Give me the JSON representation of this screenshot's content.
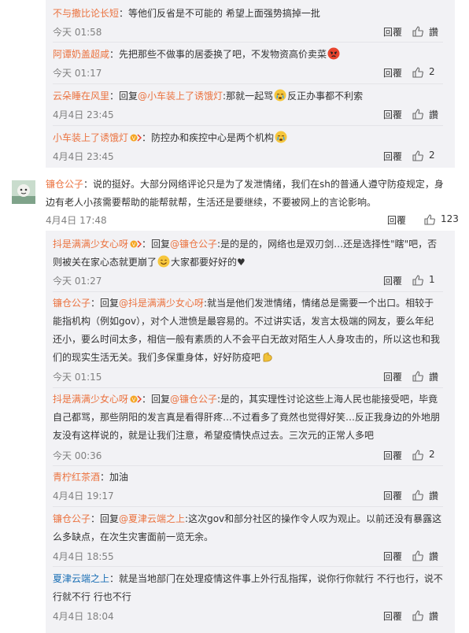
{
  "sub_replies_top": [
    {
      "user": "不与撒比论长短",
      "user_color": "#eb7340",
      "sep": "：",
      "text": "等他们反省是不可能的 希望上面强势搞掉一批",
      "time": "今天 01:58",
      "reply": "回覆",
      "like": "讚"
    },
    {
      "user": "阿谭奶盖超咸",
      "user_color": "#eb7340",
      "sep": "：",
      "text": "先把那些不做事的居委换了吧，不发物资高价卖菜",
      "emoji": "angry-face-icon",
      "time": "今天 01:17",
      "reply": "回覆",
      "like": "2"
    },
    {
      "user": "云朵睡在风里",
      "user_color": "#eb7340",
      "sep": "：回复",
      "mention": "@小车装上了诱饿灯",
      "text_a": ":那就一起骂",
      "emoji": "crying-face-icon",
      "text_b": "反正办事都不利索",
      "time": "4月4日 23:45",
      "reply": "回覆",
      "like": "讚"
    },
    {
      "user": "小车装上了诱饿灯",
      "user_color": "#eb7340",
      "vip": true,
      "sep": "：",
      "text": "防控办和疾控中心是两个机构",
      "emoji": "crying-face-icon",
      "time": "4月4日 23:45",
      "reply": "回覆",
      "like": "2"
    }
  ],
  "top_comment": {
    "user": "镰仓公子",
    "sep": "：",
    "text": "说的挺好。大部分网络评论只是为了发泄情绪，我们在sh的普通人遵守防疫规定，身边有老人小孩需要帮助的能帮就帮，生活还是要继续，不要被网上的言论影响。",
    "time": "4月4日 17:48",
    "reply": "回覆",
    "like": "123"
  },
  "sub_replies_bottom": [
    {
      "user": "抖是满满少女心呀",
      "user_color": "#eb7340",
      "vip": true,
      "sep": "：回复",
      "mention": "@镰仓公子",
      "text_a": ":是的是的，网络也是双刃剑…还是选择性\"瞎\"吧，否则被关在家心态就更崩了",
      "emoji": "smile-face-icon",
      "text_b": "大家都要好好的♥",
      "time": "今天 01:27",
      "reply": "回覆",
      "like": "1"
    },
    {
      "user": "镰仓公子",
      "user_color": "#eb7340",
      "sep": "：回复",
      "mention": "@抖是满满少女心呀",
      "text_a": ":就当是他们发泄情绪，情绪总是需要一个出口。相较于能指机构（例如gov），对个人泄愤是最容易的。不过讲实话，发言太极端的网友，要么年纪还小，要么时间太多，相信一般有素质的人不会平白无故对陌生人人身攻击的，所以这也和我们的现实生活无关。我们多保重身体，好好防疫吧",
      "emoji": "muscle-icon",
      "text_b": "",
      "time": "今天 01:15",
      "reply": "回覆",
      "like": "讚"
    },
    {
      "user": "抖是满满少女心呀",
      "user_color": "#eb7340",
      "vip": true,
      "sep": "：回复",
      "mention": "@镰仓公子",
      "text_a": ":是的，其实理性讨论这些上海人民也能接受吧，毕竟自己都骂，那些阴阳的发言真是看得肝疼…不过看多了竟然也觉得好笑…反正我身边的外地朋友没有这样说的，就是让我们注意，希望疫情快点过去。三次元的正常人多吧",
      "emoji": "",
      "text_b": "",
      "time": "今天 00:36",
      "reply": "回覆",
      "like": "2"
    },
    {
      "user": "青柠红茶酒",
      "user_color": "#eb7340",
      "sep": "：",
      "text": "加油",
      "time": "4月4日 19:17",
      "reply": "回覆",
      "like": "讚"
    },
    {
      "user": "镰仓公子",
      "user_color": "#eb7340",
      "sep": "：回复",
      "mention": "@夏津云端之上",
      "text_a": ":这次gov和部分社区的操作令人叹为观止。以前还没有暴露这么多缺点，在次生灾害面前一览无余。",
      "emoji": "",
      "text_b": "",
      "time": "4月4日 18:55",
      "reply": "回覆",
      "like": "讚"
    },
    {
      "user": "夏津云端之上",
      "user_color": "#1a6fb5",
      "sep": "：",
      "text": "就是当地部门在处理疫情这件事上外行乱指挥，说你行你就行 不行也行，说不行就不行 行也不行",
      "time": "4月4日 18:04",
      "reply": "回覆",
      "like": "讚"
    }
  ],
  "colors": {
    "username": "#eb7340",
    "link": "#eb7340",
    "meta": "#808080",
    "reply_bg": "#f2f2f5",
    "separator": "#e4e4e8"
  }
}
